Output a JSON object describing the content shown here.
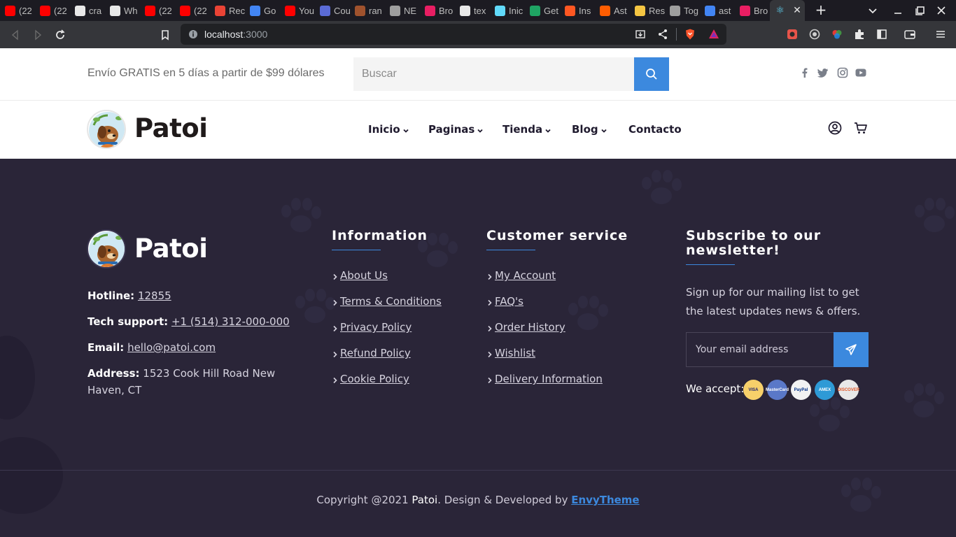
{
  "browser": {
    "tabs": [
      {
        "favicon": "youtube-icon",
        "label": "(22",
        "color": "#ff0000"
      },
      {
        "favicon": "youtube-icon",
        "label": "(22",
        "color": "#ff0000"
      },
      {
        "favicon": "github-icon",
        "label": "cra",
        "color": "#e8e8e8"
      },
      {
        "favicon": "paw-icon",
        "label": "Wh",
        "color": "#e8e8e8"
      },
      {
        "favicon": "youtube-icon",
        "label": "(22",
        "color": "#ff0000"
      },
      {
        "favicon": "youtube-icon",
        "label": "(22",
        "color": "#ff0000"
      },
      {
        "favicon": "gmail-icon",
        "label": "Rec",
        "color": "#ea4335"
      },
      {
        "favicon": "translate-icon",
        "label": "Go",
        "color": "#4285f4"
      },
      {
        "favicon": "youtube-music-icon",
        "label": "You",
        "color": "#ff0000"
      },
      {
        "favicon": "course-icon",
        "label": "Cou",
        "color": "#5b6bd6"
      },
      {
        "favicon": "photo-icon",
        "label": "ran",
        "color": "#a0522d"
      },
      {
        "favicon": "gamepad-icon",
        "label": "NE",
        "color": "#9e9e9e"
      },
      {
        "favicon": "brand-icon",
        "label": "Bro",
        "color": "#e91e63"
      },
      {
        "favicon": "github-icon",
        "label": "tex",
        "color": "#e8e8e8"
      },
      {
        "favicon": "react-icon",
        "label": "Inic",
        "color": "#61dafb"
      },
      {
        "favicon": "doc-icon",
        "label": "Get",
        "color": "#1fa463"
      },
      {
        "favicon": "download-icon",
        "label": "Ins",
        "color": "#ff5722"
      },
      {
        "favicon": "astro-icon",
        "label": "Ast",
        "color": "#ff5d01"
      },
      {
        "favicon": "bowl-icon",
        "label": "Res",
        "color": "#f5c542"
      },
      {
        "favicon": "toggle-icon",
        "label": "Tog",
        "color": "#9e9e9e"
      },
      {
        "favicon": "google-icon",
        "label": "ast",
        "color": "#4285f4"
      },
      {
        "favicon": "brand-icon",
        "label": "Bro",
        "color": "#e91e63"
      }
    ],
    "url_host": "localhost",
    "url_port": ":3000"
  },
  "header": {
    "shipping_text": "Envío GRATIS en 5 días a partir de $99 dólares",
    "search_placeholder": "Buscar",
    "social": [
      "facebook-icon",
      "twitter-icon",
      "instagram-icon",
      "youtube-icon"
    ]
  },
  "nav": {
    "logo_text": "Patoi",
    "items": [
      {
        "label": "Inicio",
        "dropdown": true
      },
      {
        "label": "Paginas",
        "dropdown": true
      },
      {
        "label": "Tienda",
        "dropdown": true
      },
      {
        "label": "Blog",
        "dropdown": true
      },
      {
        "label": "Contacto",
        "dropdown": false
      }
    ]
  },
  "footer": {
    "logo_text": "Patoi",
    "hotline_label": "Hotline:",
    "hotline_value": "12855",
    "tech_label": "Tech support:",
    "tech_value": "+1 (514) 312-000-000",
    "email_label": "Email:",
    "email_value": "hello@patoi.com",
    "address_label": "Address:",
    "address_line1": "1523 Cook Hill Road New",
    "address_line2": "Haven, CT",
    "information": {
      "title": "Information",
      "links": [
        "About Us",
        "Terms & Conditions",
        "Privacy Policy",
        "Refund Policy",
        "Cookie Policy"
      ]
    },
    "customer_service": {
      "title": "Customer service",
      "links": [
        "My Account",
        "FAQ's",
        "Order History",
        "Wishlist",
        "Delivery Information"
      ]
    },
    "newsletter": {
      "title_line1": "Subscribe to our",
      "title_line2": "newsletter!",
      "text": "Sign up for our mailing list to get the latest updates news & offers.",
      "email_placeholder": "Your email address",
      "we_accept": "We accept:",
      "payments": [
        "VISA",
        "MasterCard",
        "PayPal",
        "AMEX",
        "DISCOVER"
      ]
    },
    "copyright_prefix": "Copyright @2021",
    "copyright_brand": "Patoi",
    "copyright_mid": ". Design & Developed by",
    "copyright_dev": "EnvyTheme"
  },
  "colors": {
    "accent": "#3c89de",
    "footer_bg": "#2a2538",
    "brand_dark": "#1f1a2e"
  }
}
